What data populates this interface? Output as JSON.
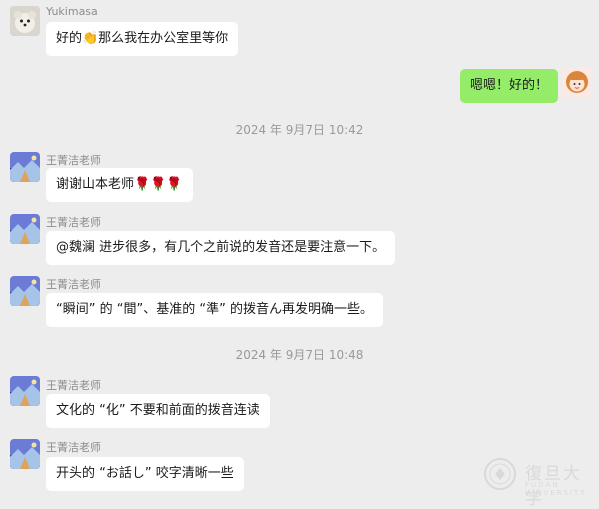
{
  "messages": [
    {
      "sender": "Yukimasa",
      "text": "好的👏那么我在办公室里等你",
      "side": "left"
    },
    {
      "text": "嗯嗯！好的！",
      "side": "right"
    },
    {
      "timestamp": "2024 年 9月7日 10:42"
    },
    {
      "sender": "王菁洁老师",
      "text": "谢谢山本老师🌹🌹🌹",
      "side": "left"
    },
    {
      "sender": "王菁洁老师",
      "text": "@魏澜 进步很多，有几个之前说的发音还是要注意一下。",
      "side": "left"
    },
    {
      "sender": "王菁洁老师",
      "text": "“瞬间” 的 “間”、基准的 “準” 的拨音ん再发明确一些。",
      "side": "left"
    },
    {
      "timestamp": "2024 年 9月7日 10:48"
    },
    {
      "sender": "王菁洁老师",
      "text": "文化的 “化” 不要和前面的拨音连读",
      "side": "left"
    },
    {
      "sender": "王菁洁老师",
      "text": "开头的 “お話し” 咬字清晰一些",
      "side": "left"
    }
  ],
  "watermark": {
    "text": "復旦大学",
    "sub": "FUDAN UNIVERSITY"
  },
  "colors": {
    "background": "#ededed",
    "bubble_left": "#ffffff",
    "bubble_right": "#95ec69",
    "meta_text": "#8c8c8c"
  }
}
